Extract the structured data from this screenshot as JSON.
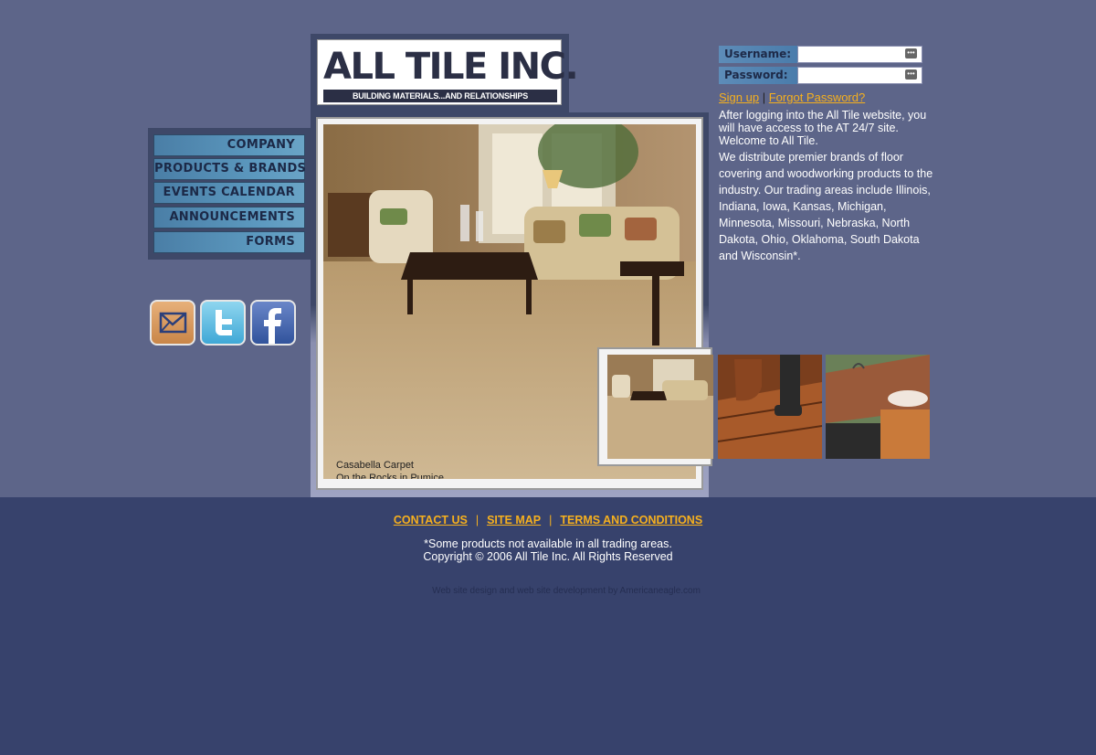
{
  "logo": {
    "name": "ALL TILE INC.",
    "tagline": "BUILDING MATERIALS...AND RELATIONSHIPS"
  },
  "nav": {
    "items": [
      "COMPANY",
      "PRODUCTS & BRANDS",
      "EVENTS CALENDAR",
      "ANNOUNCEMENTS",
      "FORMS"
    ]
  },
  "social": [
    "email-icon",
    "twitter-icon",
    "facebook-icon"
  ],
  "photo": {
    "caption_line1": "Casabella Carpet",
    "caption_line2": "On the Rocks in Pumice"
  },
  "login": {
    "username_label": "Username:",
    "password_label": "Password:",
    "username_value": "",
    "password_value": "",
    "signup": "Sign up",
    "separator": "|",
    "forgot": "Forgot Password?"
  },
  "intro": {
    "p1": "After logging into the All Tile website, you will have access to the AT 24/7 site. Welcome to All Tile.",
    "p2": "We distribute premier brands of floor covering and woodworking products to the industry. Our trading areas include Illinois, Indiana, Iowa, Kansas, Michigan, Minnesota, Missouri, Nebraska, North Dakota, Ohio, Oklahoma, South Dakota and Wisconsin*."
  },
  "footer": {
    "links": [
      "CONTACT US",
      "SITE MAP",
      "TERMS AND CONDITIONS"
    ],
    "separator": "|",
    "note": "*Some products not available in all trading areas.",
    "copyright": "Copyright © 2006 All Tile Inc. All Rights Reserved",
    "credit": "Web site design and web site development by Americaneagle.com"
  },
  "colors": {
    "page_bg": "#5d6589",
    "footer_bg": "#37426c",
    "link": "#f6b01e"
  }
}
